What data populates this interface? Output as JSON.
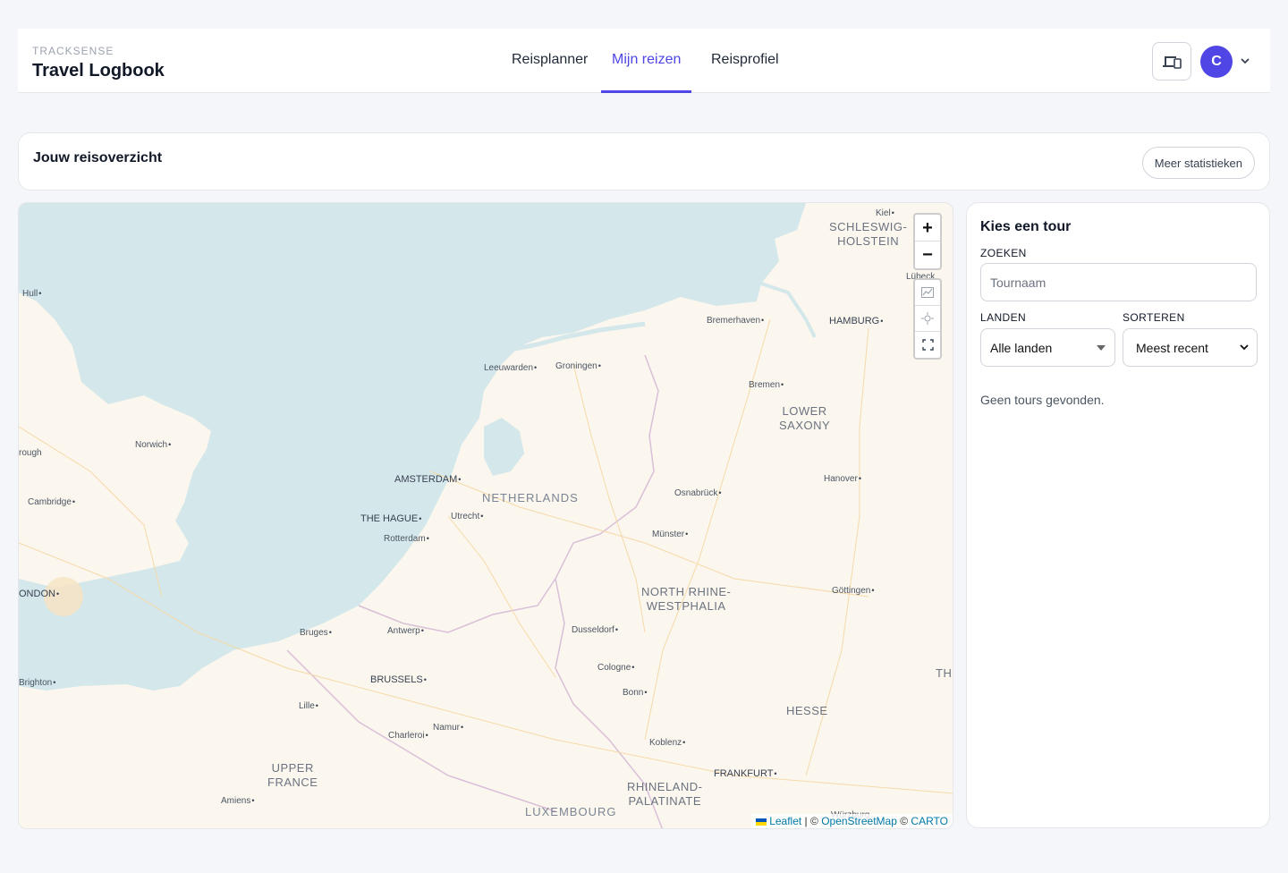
{
  "brand": {
    "kicker": "TRACKSENSE",
    "title": "Travel Logbook"
  },
  "nav": {
    "tabs": [
      {
        "label": "Reisplanner"
      },
      {
        "label": "Mijn reizen"
      },
      {
        "label": "Reisprofiel"
      }
    ],
    "active": "Mijn reizen"
  },
  "user": {
    "avatar_initial": "C"
  },
  "overview": {
    "title": "Jouw reisoverzicht",
    "stats_button": "Meer statistieken"
  },
  "map": {
    "zoom_in": "+",
    "zoom_out": "−",
    "labels": {
      "kiel": "Kiel",
      "schleswig": "SCHLESWIG-\nHOLSTEIN",
      "lubeck": "Lübeck",
      "hull": "Hull",
      "bremerhaven": "Bremerhaven",
      "hamburg": "HAMBURG",
      "leeuwarden": "Leeuwarden",
      "groningen": "Groningen",
      "bremen": "Bremen",
      "lower_saxony": "LOWER\nSAXONY",
      "norwich": "Norwich",
      "rough": "rough",
      "amsterdam": "AMSTERDAM",
      "netherlands": "NETHERLANDS",
      "osnabruck": "Osnabrück",
      "hanover": "Hanover",
      "cambridge": "Cambridge",
      "the_hague": "THE HAGUE",
      "utrecht": "Utrecht",
      "rotterdam": "Rotterdam",
      "munster": "Münster",
      "london": "ONDON",
      "nrw": "NORTH RHINE-\nWESTPHALIA",
      "gottingen": "Göttingen",
      "bruges": "Bruges",
      "antwerp": "Antwerp",
      "dusseldorf": "Dusseldorf",
      "cologne": "Cologne",
      "th": "TH",
      "brighton": "Brighton",
      "brussels": "BRUSSELS",
      "bonn": "Bonn",
      "lille": "Lille",
      "hesse": "HESSE",
      "namur": "Namur",
      "charleroi": "Charleroi",
      "koblenz": "Koblenz",
      "upper_france": "UPPER\nFRANCE",
      "frankfurt": "FRANKFURT",
      "rhineland": "RHINELAND-\nPALATINATE",
      "amiens": "Amiens",
      "luxembourg": "LUXEMBOURG",
      "wurzburg": "Würzburg"
    },
    "attribution": {
      "leaflet": "Leaflet",
      "sep1": " | © ",
      "osm": "OpenStreetMap",
      "sep2": " © ",
      "carto": "CARTO"
    }
  },
  "panel": {
    "title": "Kies een tour",
    "search_label": "ZOEKEN",
    "search_placeholder": "Tournaam",
    "countries_label": "LANDEN",
    "countries_value": "Alle landen",
    "sort_label": "SORTEREN",
    "sort_value": "Meest recent",
    "empty_text": "Geen tours gevonden."
  },
  "colors": {
    "accent": "#4f46e5",
    "sea": "#d4e7ea",
    "land": "#fbf7ee"
  }
}
